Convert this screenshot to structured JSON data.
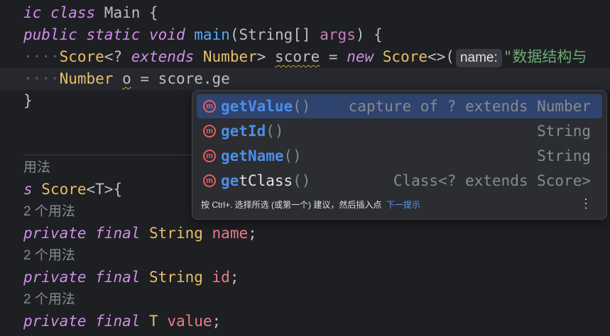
{
  "code": {
    "l1": {
      "t1": "ic ",
      "t2": "class ",
      "t3": "Main ",
      "t4": "{"
    },
    "l2": {
      "t1": "public ",
      "t2": "static ",
      "t3": "void ",
      "t4": "main",
      "t5": "(String[] ",
      "t6": "args",
      "t7": ") {"
    },
    "l3": {
      "dots": "····",
      "t1": "Score",
      "t2": "<? ",
      "t3": "extends ",
      "t4": "Number",
      "t5": "> ",
      "t6": "score",
      "t7": " = ",
      "t8": "new ",
      "t9": "Score",
      "t10": "<>(",
      "hint": "name:",
      "t11": "\"数据结构与"
    },
    "l4": {
      "dots": "····",
      "t1": "Number ",
      "t2": "o",
      "t3": " = score.ge"
    },
    "l5": {
      "t1": "}"
    },
    "l6": {
      "t1": "用法"
    },
    "l7": {
      "t1": "s ",
      "t2": "Score",
      "t3": "<T>{"
    },
    "u1": "2 个用法",
    "l8": {
      "t1": "private ",
      "t2": "final ",
      "t3": "String ",
      "t4": "name",
      "t5": ";"
    },
    "u2": "2 个用法",
    "l9": {
      "t1": "private ",
      "t2": "final ",
      "t3": "String ",
      "t4": "id",
      "t5": ";"
    },
    "u3": "2 个用法",
    "l10": {
      "t1": "private ",
      "t2": "final ",
      "t3": "T ",
      "t4": "value",
      "t5": ";"
    }
  },
  "completion": {
    "items": [
      {
        "icon": "method-icon",
        "icon_letter": "m",
        "match": "get",
        "rest": "Value",
        "paren": "()",
        "type": "capture of ? extends Number",
        "selected": true
      },
      {
        "icon": "method-icon",
        "icon_letter": "m",
        "match": "get",
        "rest": "Id",
        "paren": "()",
        "type": "String",
        "selected": false
      },
      {
        "icon": "method-icon",
        "icon_letter": "m",
        "match": "get",
        "rest": "Name",
        "paren": "()",
        "type": "String",
        "selected": false
      },
      {
        "icon": "method-icon",
        "icon_letter": "m",
        "match": "ge",
        "rest": "tClass",
        "paren": "()",
        "type": "Class<? extends Score>",
        "selected": false
      }
    ],
    "footer_text": "按 Ctrl+. 选择所选 (或第一个) 建议，然后插入点",
    "footer_link": "下一提示",
    "more_icon": "⋮"
  },
  "colors": {
    "background": "#1e1f22",
    "keyword": "#cf8ee8",
    "class": "#e8bf6a",
    "function": "#56a8f5",
    "field": "#ef7b8b",
    "selection": "#2e436e",
    "match": "#4d8dea"
  }
}
